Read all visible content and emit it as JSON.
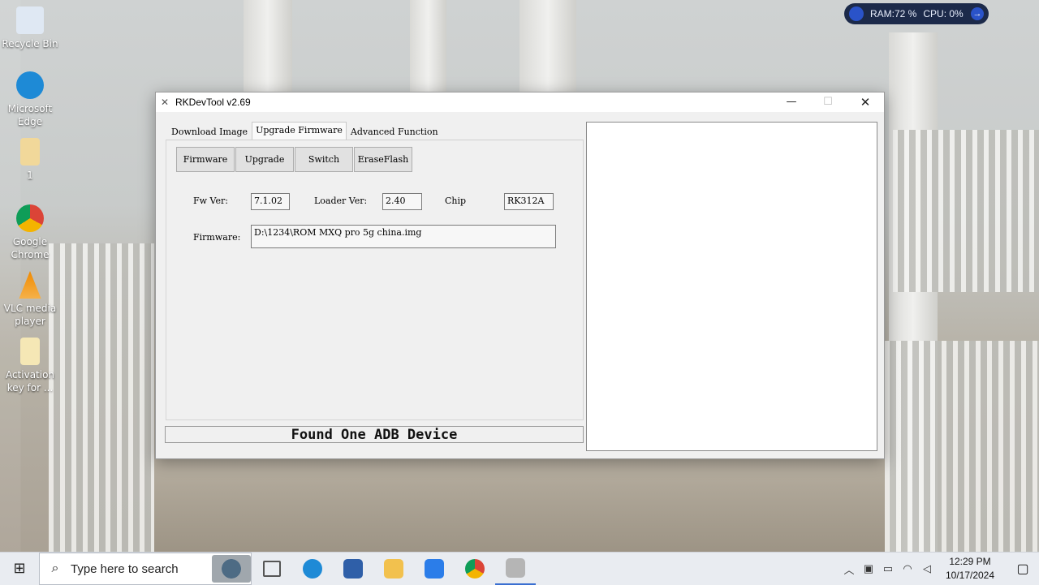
{
  "desktop": {
    "icons": [
      {
        "label": "Recycle Bin",
        "color": "#dfe8f3"
      },
      {
        "label": "Microsoft Edge",
        "color": "#1e8ad6"
      },
      {
        "label": "1",
        "color": "#f1d89a"
      },
      {
        "label": "Google Chrome",
        "color": "#db4437"
      },
      {
        "label": "VLC media player",
        "color": "#f08a00"
      },
      {
        "label": "Activation key for ...",
        "color": "#f5e7b5"
      }
    ]
  },
  "perf_widget": {
    "ram": "RAM:72 %",
    "cpu": "CPU: 0%"
  },
  "window": {
    "title": "RKDevTool v2.69",
    "min_glyph": "—",
    "max_glyph": "☐",
    "close_glyph": "✕",
    "tabs": [
      "Download Image",
      "Upgrade Firmware",
      "Advanced Function"
    ],
    "active_tab": "Upgrade Firmware",
    "buttons": [
      "Firmware",
      "Upgrade",
      "Switch",
      "EraseFlash"
    ],
    "fields": {
      "fw_ver_label": "Fw Ver:",
      "fw_ver_value": "7.1.02",
      "loader_ver_label": "Loader Ver:",
      "loader_ver_value": "2.40",
      "chip_info_label": "Chip Info:",
      "chip_info_value": "RK312A",
      "firmware_label": "Firmware:",
      "firmware_value": "D:\\1234\\ROM MXQ pro 5g china.img"
    },
    "status": "Found One ADB Device"
  },
  "taskbar": {
    "search_placeholder": "Type here to search",
    "time": "12:29 PM",
    "date": "10/17/2024",
    "apps": [
      {
        "name": "task-view",
        "color": "#555555"
      },
      {
        "name": "edge",
        "color": "#1e8ad6"
      },
      {
        "name": "app-blue",
        "color": "#2f5fa8"
      },
      {
        "name": "file-explorer",
        "color": "#f2c14e"
      },
      {
        "name": "photos",
        "color": "#2b7de9"
      },
      {
        "name": "chrome",
        "color": "#db4437"
      },
      {
        "name": "rkdevtool",
        "color": "#9a9a9a"
      }
    ]
  }
}
